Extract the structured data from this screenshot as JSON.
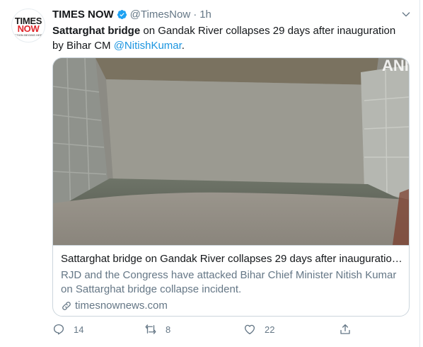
{
  "account": {
    "avatar_line1": "TIMES",
    "avatar_line2": "NOW",
    "avatar_tagline": "ACTION BEGINS HERE",
    "name": "TIMES NOW",
    "handle": "@TimesNow",
    "separator": "·",
    "time": "1h"
  },
  "tweet": {
    "bold_text": "Sattarghat bridge",
    "text_rest": " on Gandak River collapses 29 days after inauguration by Bihar CM ",
    "mention": "@NitishKumar",
    "trailing": "."
  },
  "card": {
    "title": "Sattarghat bridge on Gandak River collapses 29 days after inauguration ...",
    "description": "RJD and the Congress have attacked Bihar Chief Minister Nitish Kumar on Sattarghat bridge collapse incident.",
    "domain": "timesnownews.com",
    "watermark": "ANI"
  },
  "actions": {
    "replies": "14",
    "retweets": "8",
    "likes": "22"
  },
  "colors": {
    "accent": "#1b95e0",
    "verified": "#1da1f2",
    "secondary_text": "#657786",
    "border": "#ccd6dd",
    "brand_red": "#e0262b"
  },
  "icons": [
    "verified-badge-icon",
    "chevron-down-icon",
    "link-icon",
    "reply-icon",
    "retweet-icon",
    "like-icon",
    "share-icon"
  ]
}
